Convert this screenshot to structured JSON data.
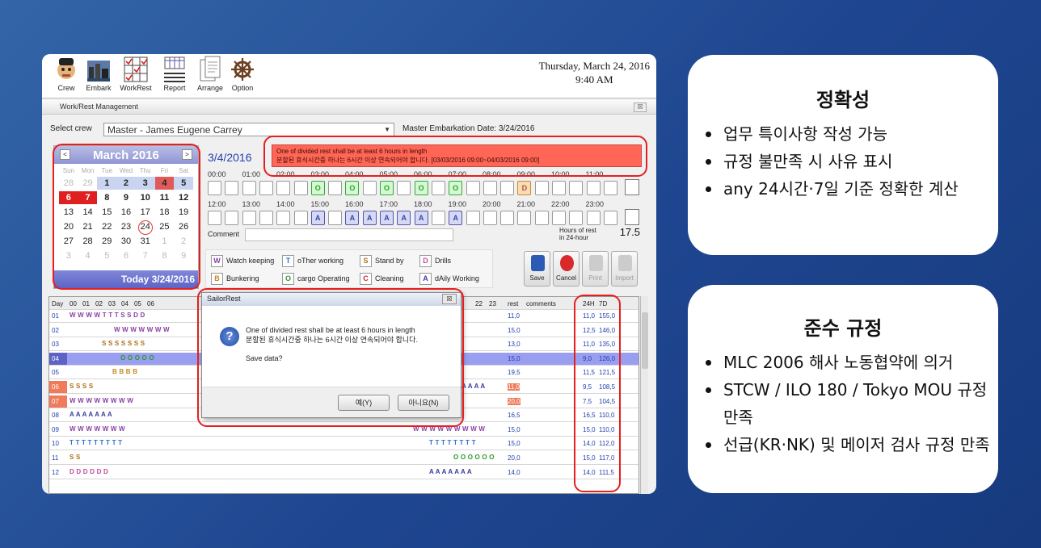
{
  "screenshot": {
    "toolbar": [
      {
        "key": "crew",
        "label": "Crew"
      },
      {
        "key": "embark",
        "label": "Embark"
      },
      {
        "key": "workrest",
        "label": "WorkRest"
      },
      {
        "key": "report",
        "label": "Report"
      },
      {
        "key": "arrange",
        "label": "Arrange"
      },
      {
        "key": "option",
        "label": "Option"
      }
    ],
    "datetime": {
      "date": "Thursday, March 24, 2016",
      "time": "9:40 AM"
    },
    "window_title": "Work/Rest Management",
    "window_close": "☒",
    "select_crew_label": "Select crew",
    "crew_value": "Master - James Eugene Carrey",
    "crew_info": "Master   Embarkation Date: 3/24/2016",
    "calendar": {
      "month": "March 2016",
      "prev": "<",
      "next": ">",
      "weekdays": [
        "Sun",
        "Mon",
        "Tue",
        "Wed",
        "Thu",
        "Fri",
        "Sat"
      ],
      "weeks": [
        [
          "28",
          "29",
          "1",
          "2",
          "3",
          "4",
          "5"
        ],
        [
          "6",
          "7",
          "8",
          "9",
          "10",
          "11",
          "12"
        ],
        [
          "13",
          "14",
          "15",
          "16",
          "17",
          "18",
          "19"
        ],
        [
          "20",
          "21",
          "22",
          "23",
          "24",
          "25",
          "26"
        ],
        [
          "27",
          "28",
          "29",
          "30",
          "31",
          "1",
          "2"
        ],
        [
          "3",
          "4",
          "5",
          "6",
          "7",
          "8",
          "9"
        ]
      ],
      "today_label": "Today  3/24/2016"
    },
    "selected_date": "3/4/2016",
    "warning": {
      "line1": "One of divided rest shall be at least 6 hours in length",
      "line2": "분할된 휴식시간중 하나는 6시간 이상 연속되어야 합니다. [03/03/2016 09:00~04/03/2016 09:00]"
    },
    "hours_am": [
      "00:00",
      "01:00",
      "02:00",
      "03:00",
      "04:00",
      "05:00",
      "06:00",
      "07:00",
      "08:00",
      "09:00",
      "10:00",
      "11:00"
    ],
    "hours_pm": [
      "12:00",
      "13:00",
      "14:00",
      "15:00",
      "16:00",
      "17:00",
      "18:00",
      "19:00",
      "20:00",
      "21:00",
      "22:00",
      "23:00"
    ],
    "slots_am": [
      "",
      "",
      "",
      "",
      "",
      "",
      "O",
      "",
      "O",
      "",
      "O",
      "",
      "O",
      "",
      "O",
      "",
      "",
      "",
      "D",
      "",
      "",
      "",
      "",
      ""
    ],
    "slots_pm": [
      "",
      "",
      "",
      "",
      "",
      "",
      "A",
      "",
      "A",
      "A",
      "A",
      "A",
      "A",
      "",
      "A",
      "",
      "",
      "",
      "",
      "",
      "",
      "",
      "",
      ""
    ],
    "comment_label": "Comment",
    "hours_rest": {
      "label1": "Hours of rest",
      "label2": "in 24-hour",
      "value": "17.5"
    },
    "legend": [
      {
        "code": "W",
        "label": "Watch keeping",
        "color": "#8a3fa8"
      },
      {
        "code": "T",
        "label": "oTher working",
        "color": "#2f6fd0"
      },
      {
        "code": "S",
        "label": "Stand by",
        "color": "#b0701a"
      },
      {
        "code": "D",
        "label": "Drills",
        "color": "#c04a9c"
      },
      {
        "code": "B",
        "label": "Bunkering",
        "color": "#c08a20"
      },
      {
        "code": "O",
        "label": "cargo Operating",
        "color": "#2a9a2a"
      },
      {
        "code": "C",
        "label": "Cleaning",
        "color": "#c03030"
      },
      {
        "code": "A",
        "label": "dAily Working",
        "color": "#3a3a9a"
      }
    ],
    "actions": [
      {
        "key": "save",
        "label": "Save"
      },
      {
        "key": "cancel",
        "label": "Cancel"
      },
      {
        "key": "print",
        "label": "Print"
      },
      {
        "key": "import",
        "label": "Import"
      }
    ],
    "table_headers": {
      "day": "Day",
      "hours": [
        "00",
        "01",
        "02",
        "03",
        "04",
        "05",
        "06"
      ],
      "hours_right": [
        "22",
        "23"
      ],
      "rest": "rest",
      "comments": "comments",
      "h24": "24H",
      "d7": "7D"
    },
    "rows": [
      {
        "day": "01",
        "cells": "W W W W T T T S S D D",
        "rest": "11,0",
        "h24": "11,0",
        "d7": "155,0"
      },
      {
        "day": "02",
        "cells": "W W W W W W W",
        "rest": "15,0",
        "h24": "12,5",
        "d7": "146,0"
      },
      {
        "day": "03",
        "cells": "S S S S S S S",
        "rest": "13,0",
        "h24": "11,0",
        "d7": "135,0"
      },
      {
        "day": "04",
        "cells": "O O O O O",
        "rest": "15,0",
        "h24": "9,0",
        "d7": "126,0"
      },
      {
        "day": "05",
        "cells": "B B B B",
        "rest": "19,5",
        "h24": "11,5",
        "d7": "121,5"
      },
      {
        "day": "06",
        "cells": "S S S S",
        "right": "A A A A",
        "rest": "11,0",
        "h24": "9,5",
        "d7": "108,5"
      },
      {
        "day": "07",
        "cells": "W W W W W W W W",
        "rest": "20,0",
        "h24": "7,5",
        "d7": "104,5"
      },
      {
        "day": "08",
        "cells": "A A A A A A A",
        "rest": "16,5",
        "h24": "16,5",
        "d7": "110,0"
      },
      {
        "day": "09",
        "cells": "W W W W W W W",
        "right": "W W W W W W W W W",
        "rest": "15,0",
        "h24": "15,0",
        "d7": "110,0"
      },
      {
        "day": "10",
        "cells": "T T T T T T T T T",
        "right": "T T T T T T T T",
        "rest": "15,0",
        "h24": "14,0",
        "d7": "112,0"
      },
      {
        "day": "11",
        "cells": "S S",
        "right": "O O O O O O",
        "rest": "20,0",
        "h24": "15,0",
        "d7": "117,0"
      },
      {
        "day": "12",
        "cells": "D D D D D D",
        "right": "A A A A A A A",
        "rest": "14,0",
        "h24": "14,0",
        "d7": "111,5"
      }
    ],
    "dialog": {
      "title": "SailorRest",
      "close": "☒",
      "line1": "One of divided rest shall be at least 6 hours in length",
      "line2": "분할된 휴식시간중 하나는 6시간 이상 연속되어야 합니다.",
      "line3": "Save data?",
      "yes": "예(Y)",
      "no": "아니요(N)"
    }
  },
  "cards": [
    {
      "title": "정확성",
      "items": [
        "업무 특이사항 작성 가능",
        "규정 불만족 시 사유 표시",
        "any 24시간·7일 기준 정확한 계산"
      ]
    },
    {
      "title": "준수 규정",
      "items": [
        "MLC 2006 해사 노동협약에 의거",
        "STCW / ILO 180 / Tokyo MOU 규정 만족",
        "선급(KR·NK) 및 메이저 검사 규정 만족"
      ]
    }
  ]
}
